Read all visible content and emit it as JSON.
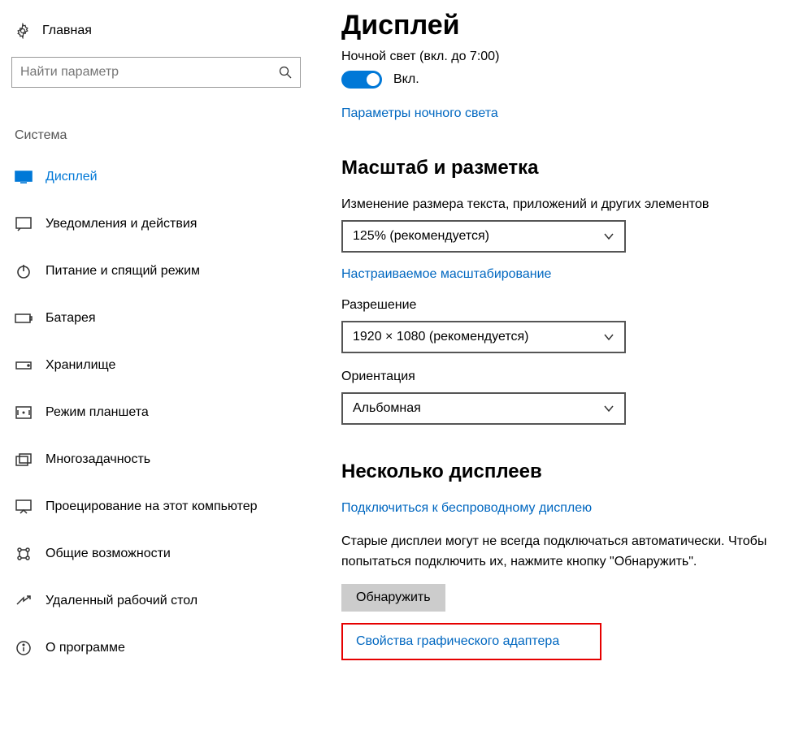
{
  "sidebar": {
    "home": "Главная",
    "search_placeholder": "Найти параметр",
    "group_title": "Система",
    "items": [
      {
        "label": "Дисплей"
      },
      {
        "label": "Уведомления и действия"
      },
      {
        "label": "Питание и спящий режим"
      },
      {
        "label": "Батарея"
      },
      {
        "label": "Хранилище"
      },
      {
        "label": "Режим планшета"
      },
      {
        "label": "Многозадачность"
      },
      {
        "label": "Проецирование на этот компьютер"
      },
      {
        "label": "Общие возможности"
      },
      {
        "label": "Удаленный рабочий стол"
      },
      {
        "label": "О программе"
      }
    ]
  },
  "main": {
    "title": "Дисплей",
    "nightlight_status": "Ночной свет (вкл. до 7:00)",
    "toggle_label": "Вкл.",
    "nightlight_link": "Параметры ночного света",
    "scale_heading": "Масштаб и разметка",
    "scale_label": "Изменение размера текста, приложений и других элементов",
    "scale_value": "125% (рекомендуется)",
    "custom_scale_link": "Настраиваемое масштабирование",
    "resolution_label": "Разрешение",
    "resolution_value": "1920 × 1080 (рекомендуется)",
    "orientation_label": "Ориентация",
    "orientation_value": "Альбомная",
    "multi_heading": "Несколько дисплеев",
    "wireless_link": "Подключиться к беспроводному дисплею",
    "detect_text": "Старые дисплеи могут не всегда подключаться автоматически. Чтобы попытаться подключить их, нажмите кнопку \"Обнаружить\".",
    "detect_button": "Обнаружить",
    "adapter_link": "Свойства графического адаптера"
  }
}
